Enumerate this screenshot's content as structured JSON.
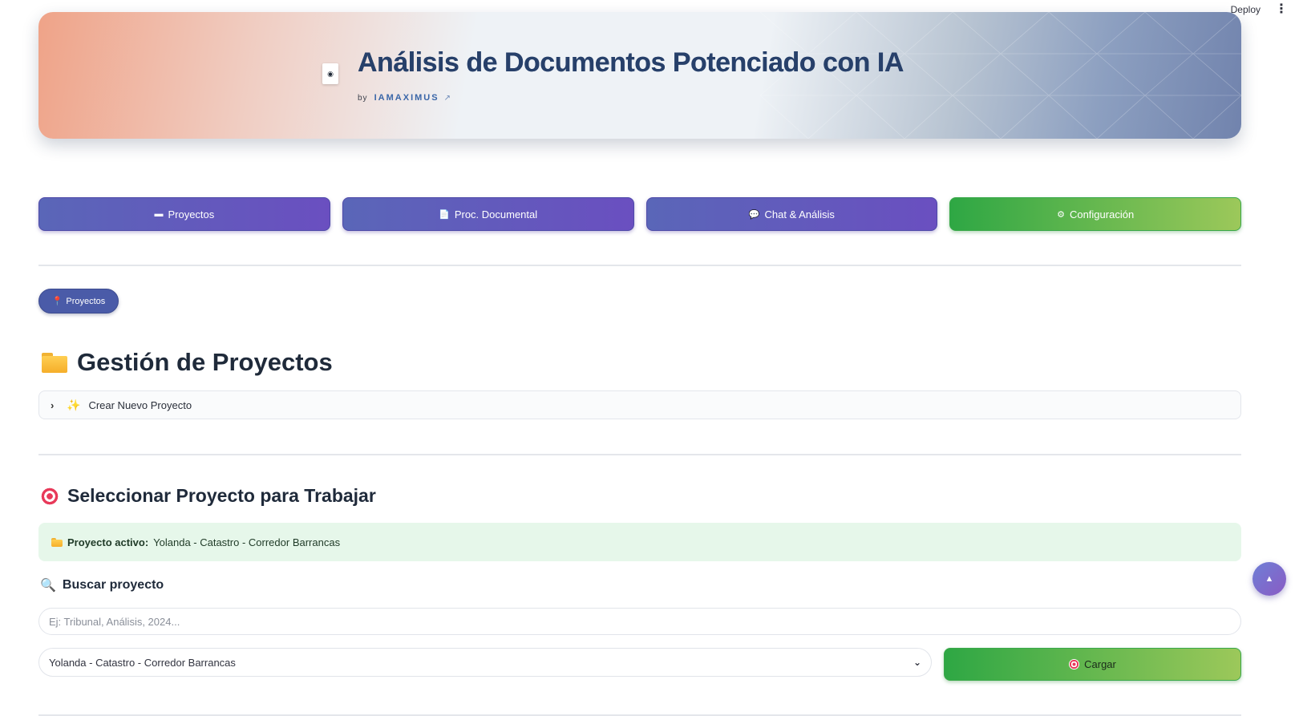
{
  "toolbar": {
    "deploy_label": "Deploy",
    "menu_icon": "kebab-menu-icon"
  },
  "hero": {
    "title": "Análisis de Documentos Potenciado con IA",
    "by_prefix": "by",
    "author": "IAMAXIMUS",
    "icon": "document-icon",
    "colors": {
      "left": "#efa388",
      "mid": "#eef2f6",
      "right": "#7183ad"
    }
  },
  "nav": {
    "items": [
      {
        "label": "Proyectos",
        "icon": "folder-icon",
        "glyph": "▬"
      },
      {
        "label": "Proc. Documental",
        "icon": "document-icon",
        "glyph": "📄"
      },
      {
        "label": "Chat & Análisis",
        "icon": "speech-bubble-icon",
        "glyph": "💬"
      },
      {
        "label": "Configuración",
        "icon": "gear-icon",
        "glyph": "⚙"
      }
    ],
    "colors": {
      "primary": "#5a66b8",
      "accent": "#6a4fc0",
      "config": "#2ea744"
    }
  },
  "breadcrumb": {
    "label": "Proyectos",
    "icon": "pin-icon"
  },
  "projects_section": {
    "title": "Gestión de Proyectos",
    "expander_label": "Crear Nuevo Proyecto"
  },
  "select_section": {
    "title": "Seleccionar Proyecto para Trabajar",
    "active_prefix": "Proyecto activo:",
    "active_value": "Yolanda - Catastro - Corredor Barrancas",
    "success_color": "#e6f7ea"
  },
  "search": {
    "title": "Buscar proyecto",
    "placeholder": "Ej: Tribunal, Análisis, 2024...",
    "value": ""
  },
  "project_select": {
    "selected": "Yolanda - Catastro - Corredor Barrancas"
  },
  "load_button": {
    "label": "Cargar"
  },
  "scroll_top": {
    "glyph": "▲",
    "icon": "arrow-up-icon"
  }
}
